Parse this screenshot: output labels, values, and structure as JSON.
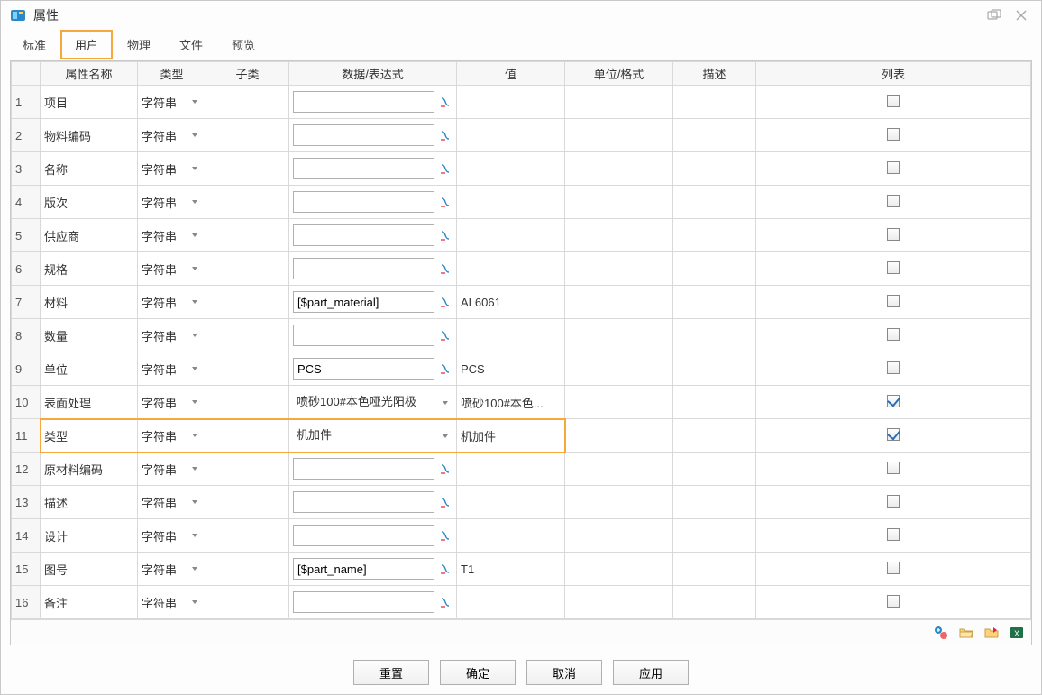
{
  "window": {
    "title": "属性"
  },
  "tabs": {
    "items": [
      {
        "label": "标准"
      },
      {
        "label": "用户",
        "active": true
      },
      {
        "label": "物理"
      },
      {
        "label": "文件"
      },
      {
        "label": "预览"
      }
    ]
  },
  "columns": {
    "rownum": "",
    "name": "属性名称",
    "type": "类型",
    "subtype": "子类",
    "expr": "数据/表达式",
    "val": "值",
    "unit": "单位/格式",
    "desc": "描述",
    "list": "列表"
  },
  "type_default": "字符串",
  "rows": [
    {
      "num": "1",
      "name": "项目",
      "expr": "",
      "expr_mode": "input",
      "val": "",
      "list": false
    },
    {
      "num": "2",
      "name": "物料编码",
      "expr": "",
      "expr_mode": "input",
      "val": "",
      "list": false
    },
    {
      "num": "3",
      "name": "名称",
      "expr": "",
      "expr_mode": "input",
      "val": "",
      "list": false
    },
    {
      "num": "4",
      "name": "版次",
      "expr": "",
      "expr_mode": "input",
      "val": "",
      "list": false
    },
    {
      "num": "5",
      "name": "供应商",
      "expr": "",
      "expr_mode": "input",
      "val": "",
      "list": false
    },
    {
      "num": "6",
      "name": "规格",
      "expr": "",
      "expr_mode": "input",
      "val": "",
      "list": false
    },
    {
      "num": "7",
      "name": "材料",
      "expr": "[$part_material]",
      "expr_mode": "input",
      "val": "AL6061",
      "list": false
    },
    {
      "num": "8",
      "name": "数量",
      "expr": "",
      "expr_mode": "input",
      "val": "",
      "list": false
    },
    {
      "num": "9",
      "name": "单位",
      "expr": "PCS",
      "expr_mode": "input",
      "val": "PCS",
      "list": false
    },
    {
      "num": "10",
      "name": "表面处理",
      "expr": "喷砂100#本色哑光阳极",
      "expr_mode": "dropdown",
      "val": "喷砂100#本色...",
      "list": true
    },
    {
      "num": "11",
      "name": "类型",
      "expr": "机加件",
      "expr_mode": "dropdown",
      "val": "机加件",
      "list": true,
      "highlight": true
    },
    {
      "num": "12",
      "name": "原材料编码",
      "expr": "",
      "expr_mode": "input",
      "val": "",
      "list": false
    },
    {
      "num": "13",
      "name": "描述",
      "expr": "",
      "expr_mode": "input",
      "val": "",
      "list": false
    },
    {
      "num": "14",
      "name": "设计",
      "expr": "",
      "expr_mode": "input",
      "val": "",
      "list": false
    },
    {
      "num": "15",
      "name": "图号",
      "expr": "[$part_name]",
      "expr_mode": "input",
      "val": "T1",
      "list": false
    },
    {
      "num": "16",
      "name": "备注",
      "expr": "",
      "expr_mode": "input",
      "val": "",
      "list": false
    }
  ],
  "buttons": {
    "reset": "重置",
    "ok": "确定",
    "cancel": "取消",
    "apply": "应用"
  }
}
